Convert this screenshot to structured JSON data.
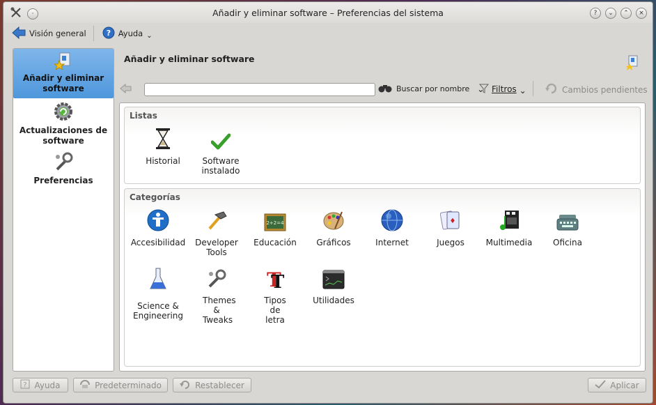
{
  "window": {
    "title": "Añadir y eliminar software – Preferencias del sistema"
  },
  "toolbar": {
    "overview_label": "Visión general",
    "help_label": "Ayuda"
  },
  "sidebar": {
    "items": [
      {
        "label": "Añadir y eliminar software",
        "icon": "software-package-icon"
      },
      {
        "label": "Actualizaciones de software",
        "icon": "update-gear-icon"
      },
      {
        "label": "Preferencias",
        "icon": "wrench-preferences-icon"
      }
    ]
  },
  "main": {
    "title": "Añadir y eliminar software",
    "search": {
      "value": "",
      "find_label": "Buscar por nombre",
      "filters_label": "Filtros",
      "pending_label": "Cambios pendientes"
    },
    "lists": {
      "heading": "Listas",
      "items": [
        {
          "label": "Historial",
          "icon": "hourglass-icon"
        },
        {
          "label": "Software instalado",
          "icon": "checkmark-icon"
        }
      ]
    },
    "categories": {
      "heading": "Categorías",
      "items": [
        {
          "label": "Accesibilidad",
          "icon": "accessibility-icon"
        },
        {
          "label": "Developer Tools",
          "icon": "hammer-icon"
        },
        {
          "label": "Educación",
          "icon": "chalkboard-icon"
        },
        {
          "label": "Gráficos",
          "icon": "palette-icon"
        },
        {
          "label": "Internet",
          "icon": "globe-icon"
        },
        {
          "label": "Juegos",
          "icon": "cards-icon"
        },
        {
          "label": "Multimedia",
          "icon": "multimedia-icon"
        },
        {
          "label": "Oficina",
          "icon": "typewriter-icon"
        },
        {
          "label": "Science & Engineering",
          "icon": "flask-icon"
        },
        {
          "label": "Themes & Tweaks",
          "icon": "tools-icon"
        },
        {
          "label": "Tipos de letra",
          "icon": "fonts-icon"
        },
        {
          "label": "Utilidades",
          "icon": "terminal-icon"
        }
      ]
    }
  },
  "buttons": {
    "help": "Ayuda",
    "defaults": "Predeterminado",
    "reset": "Restablecer",
    "apply": "Aplicar"
  }
}
